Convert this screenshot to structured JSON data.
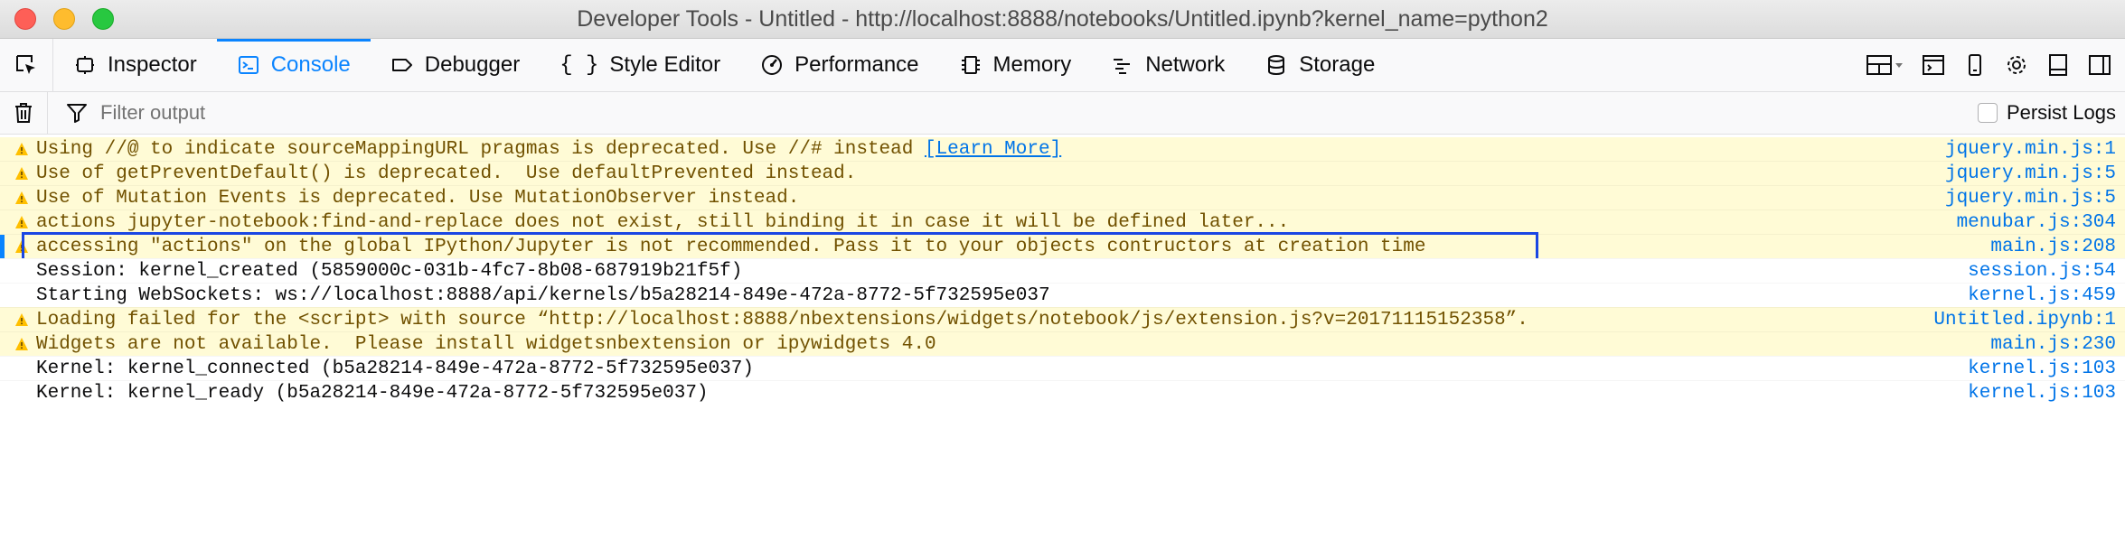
{
  "window": {
    "title": "Developer Tools - Untitled - http://localhost:8888/notebooks/Untitled.ipynb?kernel_name=python2"
  },
  "tabs": [
    {
      "label": "Inspector",
      "icon": "inspector-icon"
    },
    {
      "label": "Console",
      "icon": "console-icon",
      "selected": true
    },
    {
      "label": "Debugger",
      "icon": "debugger-icon"
    },
    {
      "label": "Style Editor",
      "icon": "style-editor-icon"
    },
    {
      "label": "Performance",
      "icon": "performance-icon"
    },
    {
      "label": "Memory",
      "icon": "memory-icon"
    },
    {
      "label": "Network",
      "icon": "network-icon"
    },
    {
      "label": "Storage",
      "icon": "storage-icon"
    }
  ],
  "toolbar": {
    "filter_placeholder": "Filter output",
    "persist_logs_label": "Persist Logs",
    "persist_logs_checked": false
  },
  "colors": {
    "accent": "#0a84ff",
    "warning_bg": "#fffbd6",
    "warning_text": "#715100",
    "link": "#0074e8",
    "highlight_box": "#1a46e3"
  },
  "messages": [
    {
      "level": "warning",
      "text": "Using //@ to indicate sourceMappingURL pragmas is deprecated. Use //# instead ",
      "link": "[Learn More]",
      "source": "jquery.min.js:1"
    },
    {
      "level": "warning",
      "text": "Use of getPreventDefault() is deprecated.  Use defaultPrevented instead.",
      "source": "jquery.min.js:5"
    },
    {
      "level": "warning",
      "text": "Use of Mutation Events is deprecated. Use MutationObserver instead.",
      "source": "jquery.min.js:5"
    },
    {
      "level": "warning",
      "text": "actions jupyter-notebook:find-and-replace does not exist, still binding it in case it will be defined later...",
      "source": "menubar.js:304"
    },
    {
      "level": "warning",
      "text": "accessing \"actions\" on the global IPython/Jupyter is not recommended. Pass it to your objects contructors at creation time",
      "source": "main.js:208",
      "highlighted": true
    },
    {
      "level": "info",
      "text": "Session: kernel_created (5859000c-031b-4fc7-8b08-687919b21f5f)",
      "source": "session.js:54"
    },
    {
      "level": "info",
      "text": "Starting WebSockets: ws://localhost:8888/api/kernels/b5a28214-849e-472a-8772-5f732595e037",
      "source": "kernel.js:459"
    },
    {
      "level": "warning",
      "text": "Loading failed for the <script> with source “http://localhost:8888/nbextensions/widgets/notebook/js/extension.js?v=20171115152358”.",
      "source": "Untitled.ipynb:1"
    },
    {
      "level": "warning",
      "text": "Widgets are not available.  Please install widgetsnbextension or ipywidgets 4.0",
      "source": "main.js:230"
    },
    {
      "level": "info",
      "text": "Kernel: kernel_connected (b5a28214-849e-472a-8772-5f732595e037)",
      "source": "kernel.js:103"
    },
    {
      "level": "info",
      "text": "Kernel: kernel_ready (b5a28214-849e-472a-8772-5f732595e037)",
      "source": "kernel.js:103"
    }
  ]
}
